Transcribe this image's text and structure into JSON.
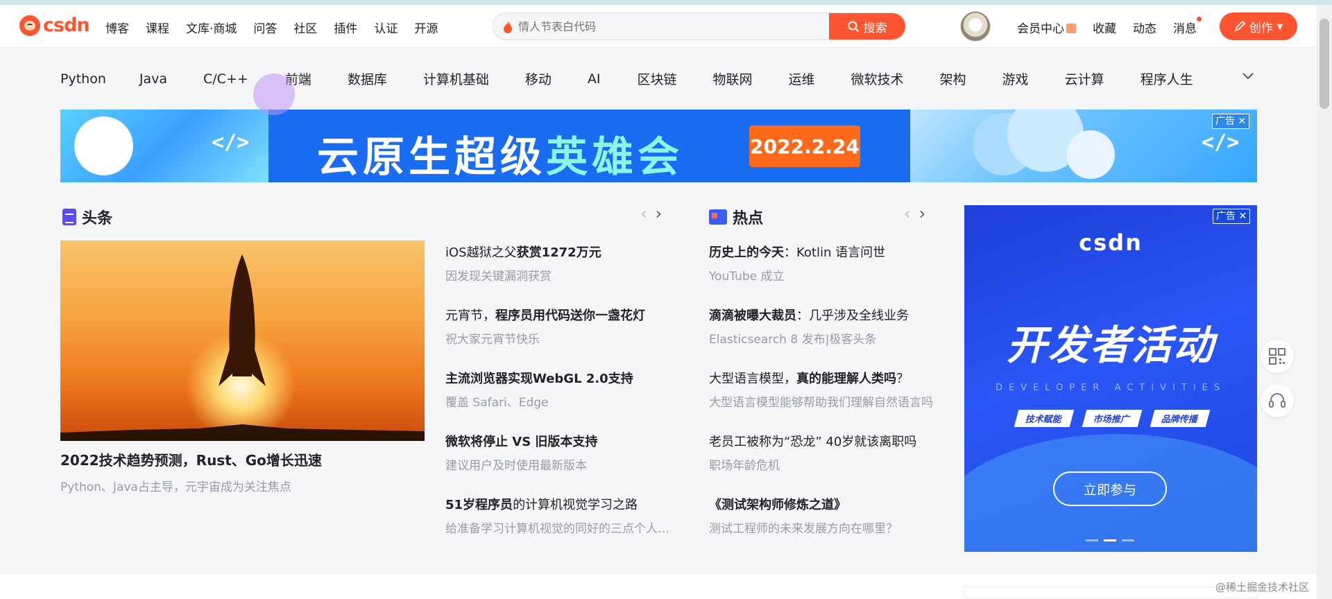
{
  "header": {
    "logo_text": "CSDN",
    "nav": [
      "博客",
      "课程",
      "文库·商城",
      "问答",
      "社区",
      "插件",
      "认证",
      "开源"
    ],
    "search": {
      "placeholder": "情人节表白代码",
      "button_label": "搜索"
    },
    "right_nav": [
      "会员中心",
      "收藏",
      "动态",
      "消息"
    ],
    "create_label": "创作"
  },
  "categories": [
    "Python",
    "Java",
    "C/C++",
    "前端",
    "数据库",
    "计算机基础",
    "移动",
    "AI",
    "区块链",
    "物联网",
    "运维",
    "微软技术",
    "架构",
    "游戏",
    "云计算",
    "程序人生"
  ],
  "banner": {
    "title_part1": "云原生超级",
    "title_part2": "英雄会",
    "date": "2022.2.24",
    "code_symbol": "</>",
    "ad_label": "广告"
  },
  "headlines": {
    "title": "头条",
    "hero": {
      "title": "2022技术趋势预测，Rust、Go增长迅速",
      "subtitle": "Python、Java占主导，元宇宙成为关注焦点"
    },
    "items": [
      {
        "title_plain": "iOS越狱之父",
        "title_bold": "获赏1272万元",
        "title_tail": "",
        "subtitle": "因发现关键漏洞获赏"
      },
      {
        "title_plain": "元宵节，",
        "title_bold": "程序员用代码送你一盏花灯",
        "title_tail": "",
        "subtitle": "祝大家元宵节快乐"
      },
      {
        "title_plain": "",
        "title_bold": "主流浏览器实现WebGL 2.0支持",
        "title_tail": "",
        "subtitle": "覆盖 Safari、Edge"
      },
      {
        "title_plain": "",
        "title_bold": "微软将停止 VS 旧版本支持",
        "title_tail": "",
        "subtitle": "建议用户及时使用最新版本"
      },
      {
        "title_plain": "",
        "title_bold": "51岁程序员",
        "title_tail": "的计算机视觉学习之路",
        "subtitle": "给准备学习计算机视觉的同好的三点个人建议"
      }
    ]
  },
  "hot": {
    "title": "热点",
    "items": [
      {
        "title_plain": "",
        "title_bold": "历史上的今天",
        "title_tail": "：Kotlin 语言问世",
        "subtitle": "YouTube 成立"
      },
      {
        "title_plain": "",
        "title_bold": "滴滴被曝大裁员",
        "title_tail": "：几乎涉及全线业务",
        "subtitle": "Elasticsearch 8 发布|极客头条"
      },
      {
        "title_plain": "大型语言模型，",
        "title_bold": "真的能理解人类吗",
        "title_tail": "？",
        "subtitle": "大型语言模型能够帮助我们理解自然语言吗"
      },
      {
        "title_plain": "老员工被称为“恐龙” 40岁就该离职吗",
        "title_bold": "",
        "title_tail": "",
        "subtitle": "职场年龄危机"
      },
      {
        "title_plain": "",
        "title_bold": "《测试架构师修炼之道》",
        "title_tail": "",
        "subtitle": "测试工程师的未来发展方向在哪里？"
      }
    ]
  },
  "side_ad": {
    "ad_label": "广告",
    "logo": "CSDN",
    "headline": "开发者活动",
    "tagline": "DEVELOPER  ACTIVITIES",
    "pills": [
      "技术赋能",
      "市场推广",
      "品牌传播"
    ],
    "button": "立即参与"
  },
  "watermark": "@稀土掘金技术社区",
  "colors": {
    "accent": "#fc5531",
    "banner_blue": "#1a6cf0",
    "ad_blue": "#2a56f5"
  }
}
